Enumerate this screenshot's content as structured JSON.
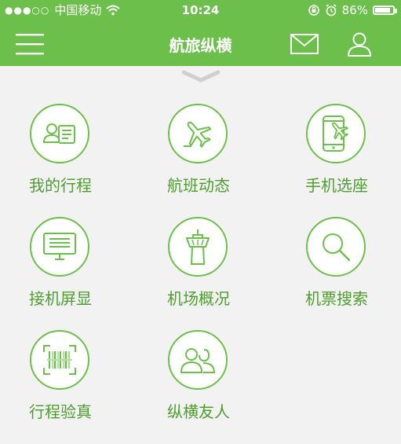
{
  "status_bar": {
    "carrier": "中国移动",
    "time": "10:24",
    "battery": "86%",
    "battery_level": 0.86
  },
  "nav": {
    "title": "航旅纵横",
    "icons": [
      "menu-icon",
      "mail-icon",
      "user-icon"
    ]
  },
  "grid": {
    "items": [
      {
        "label": "我的行程",
        "icon": "id-card-icon"
      },
      {
        "label": "航班动态",
        "icon": "airplane-icon"
      },
      {
        "label": "手机选座",
        "icon": "phone-plane-icon"
      },
      {
        "label": "接机屏显",
        "icon": "monitor-icon"
      },
      {
        "label": "机场概况",
        "icon": "tower-icon"
      },
      {
        "label": "机票搜索",
        "icon": "search-icon"
      },
      {
        "label": "行程验真",
        "icon": "barcode-icon"
      },
      {
        "label": "纵横友人",
        "icon": "friends-icon"
      }
    ]
  },
  "colors": {
    "accent": "#6cbf4b",
    "label": "#4e9d2f",
    "background": "#f2f2f2"
  }
}
